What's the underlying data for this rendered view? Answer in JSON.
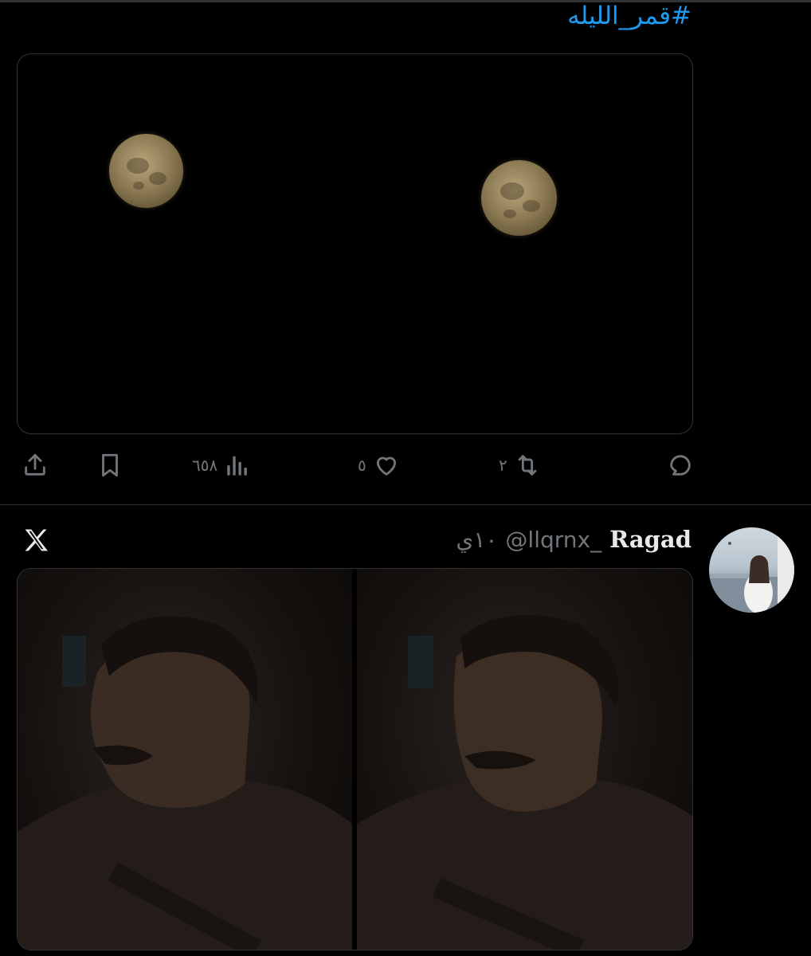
{
  "tweet1": {
    "hashtag": "#قمر_الليله",
    "actions": {
      "reply_count": "",
      "retweet_count": "٢",
      "like_count": "٥",
      "views_count": "٦٥٨"
    }
  },
  "tweet2": {
    "author_name": "Ragad",
    "author_handle": "@llqrnx_",
    "time": "١٠ي"
  },
  "icons": {
    "x_logo": "x-logo-icon",
    "reply": "reply-icon",
    "retweet": "retweet-icon",
    "like": "heart-icon",
    "views": "views-icon",
    "bookmark": "bookmark-icon",
    "share": "share-icon"
  },
  "colors": {
    "accent": "#1d9bf0",
    "muted": "#71767b",
    "text": "#e7e9ea",
    "border": "#2f3336"
  }
}
